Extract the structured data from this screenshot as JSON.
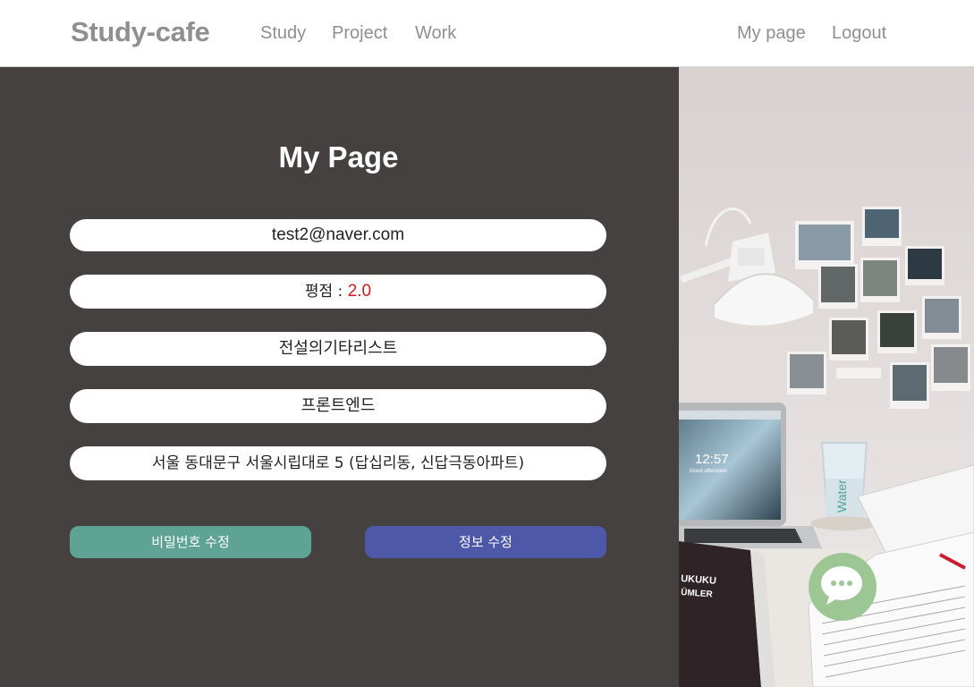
{
  "header": {
    "brand": "Study-cafe",
    "nav": [
      "Study",
      "Project",
      "Work"
    ],
    "user_nav": [
      "My page",
      "Logout"
    ]
  },
  "main": {
    "title": "My Page",
    "email": "test2@naver.com",
    "rating_label": "평점 : ",
    "rating_value": "2.0",
    "nickname": "전설의기타리스트",
    "position": "프론트엔드",
    "address": "서울 동대문구 서울시립대로 5 (답십리동, 신답극동아파트)",
    "buttons": {
      "change_password": "비밀번호 수정",
      "edit_info": "정보 수정"
    }
  },
  "image": {
    "laptop_time": "12:57",
    "laptop_greeting": "Good afternoon",
    "glass_text": "Water",
    "book_text_1": "UKUKU",
    "book_text_2": "ÜMLER"
  },
  "colors": {
    "panel_bg": "#464141",
    "password_button": "#5ea394",
    "info_button": "#4d59a8",
    "rating_value": "#d11a1a",
    "chat_button": "#9cc794",
    "nav_text": "#8f8f8f"
  },
  "icons": {
    "chat": "chat-bubble-icon"
  }
}
